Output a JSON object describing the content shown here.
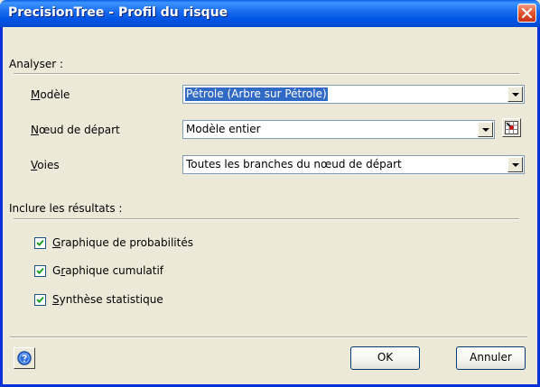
{
  "window": {
    "title": "PrecisionTree - Profil du risque"
  },
  "analyze_section": {
    "label": "Analyser :"
  },
  "fields": {
    "model": {
      "label_first": "M",
      "label_rest": "odèle",
      "value": "Pétrole (Arbre sur Pétrole)"
    },
    "start_node": {
      "label_first": "N",
      "label_rest": "œud de départ",
      "value": "Modèle entier"
    },
    "paths": {
      "label_first": "V",
      "label_rest": "oies",
      "value": "Toutes les branches du nœud de départ"
    }
  },
  "results_section": {
    "label": "Inclure les résultats :"
  },
  "checkboxes": [
    {
      "label_first": "G",
      "label_rest": "raphique de probabilités",
      "checked": true
    },
    {
      "label_pre": "G",
      "label_under": "r",
      "label_rest": "aphique cumulatif",
      "checked": true
    },
    {
      "label_first": "S",
      "label_rest": "ynthèse statistique",
      "checked": true
    }
  ],
  "buttons": {
    "ok": "OK",
    "cancel": "Annuler"
  },
  "icons": {
    "close": "close-icon",
    "tree_select": "tree-select-icon",
    "help": "help-icon"
  },
  "colors": {
    "titlebar": "#0055e5",
    "close": "#e3572f",
    "selection": "#316ac5",
    "dialog_bg": "#ece9d8"
  }
}
